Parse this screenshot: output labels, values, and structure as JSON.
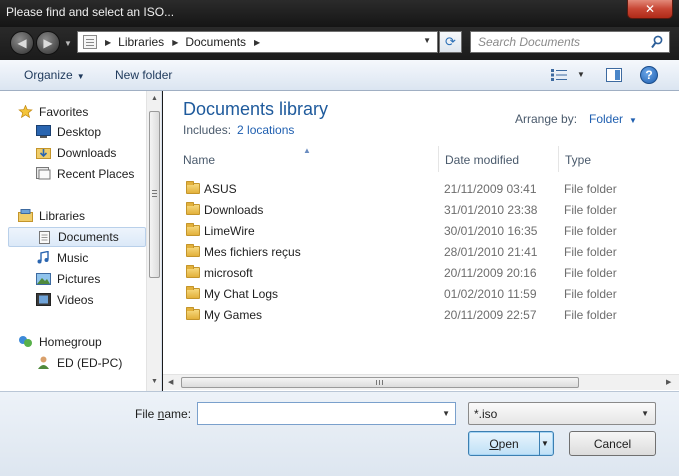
{
  "window": {
    "title": "Please find and select an ISO...",
    "close_label": "✕"
  },
  "address": {
    "crumbs": [
      "Libraries",
      "Documents"
    ],
    "search_placeholder": "Search Documents"
  },
  "toolbar": {
    "organize": "Organize",
    "new_folder": "New folder",
    "help": "?"
  },
  "nav": {
    "favorites_header": "Favorites",
    "favorites": [
      "Desktop",
      "Downloads",
      "Recent Places"
    ],
    "libraries_header": "Libraries",
    "libraries": [
      "Documents",
      "Music",
      "Pictures",
      "Videos"
    ],
    "selected": "Documents",
    "homegroup_header": "Homegroup",
    "computer": "ED (ED-PC)"
  },
  "library": {
    "title": "Documents library",
    "includes_label": "Includes:",
    "includes_link": "2 locations",
    "arrange_label": "Arrange by:",
    "arrange_value": "Folder"
  },
  "columns": {
    "name": "Name",
    "date": "Date modified",
    "type": "Type"
  },
  "files": [
    {
      "name": "ASUS",
      "date": "21/11/2009 03:41",
      "type": "File folder"
    },
    {
      "name": "Downloads",
      "date": "31/01/2010 23:38",
      "type": "File folder"
    },
    {
      "name": "LimeWire",
      "date": "30/01/2010 16:35",
      "type": "File folder"
    },
    {
      "name": "Mes fichiers reçus",
      "date": "28/01/2010 21:41",
      "type": "File folder"
    },
    {
      "name": "microsoft",
      "date": "20/11/2009 20:16",
      "type": "File folder"
    },
    {
      "name": "My Chat Logs",
      "date": "01/02/2010 11:59",
      "type": "File folder"
    },
    {
      "name": "My Games",
      "date": "20/11/2009 22:57",
      "type": "File folder"
    }
  ],
  "footer": {
    "file_name_label_pre": "File ",
    "file_name_label_accel": "n",
    "file_name_label_post": "ame:",
    "file_name_value": "",
    "filter_value": "*.iso",
    "open_accel": "O",
    "open_rest": "pen",
    "cancel_label": "Cancel"
  }
}
